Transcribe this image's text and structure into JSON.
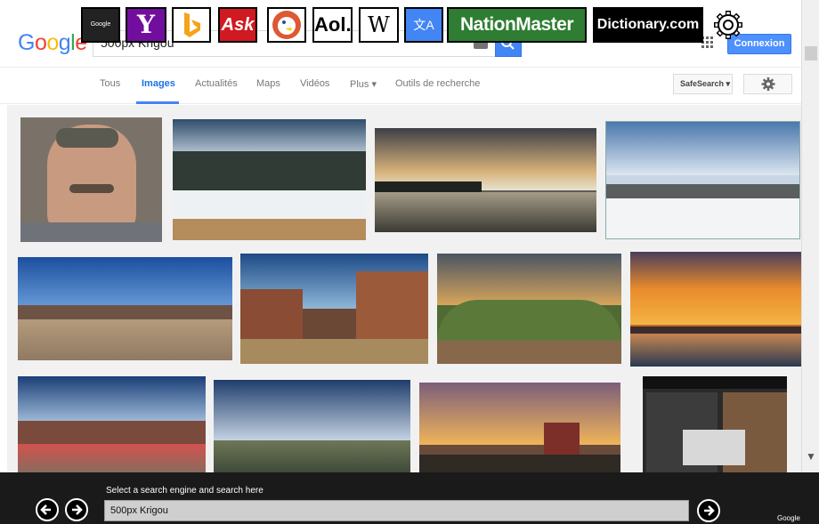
{
  "engines": [
    {
      "name": "Google",
      "label": "Google"
    },
    {
      "name": "Yahoo",
      "label": "Y"
    },
    {
      "name": "Bing",
      "label": ""
    },
    {
      "name": "Ask",
      "label": "Ask"
    },
    {
      "name": "DuckDuckGo",
      "label": ""
    },
    {
      "name": "Aol",
      "label": "Aol."
    },
    {
      "name": "Wikipedia",
      "label": "W"
    },
    {
      "name": "Translate",
      "label": "文A"
    },
    {
      "name": "NationMaster",
      "label": "NationMaster"
    },
    {
      "name": "Dictionary",
      "label": "Dictionary.com"
    }
  ],
  "google": {
    "logo_letters": [
      "G",
      "o",
      "o",
      "g",
      "l",
      "e"
    ],
    "logo_colors": [
      "#4285f4",
      "#ea4335",
      "#fbbc05",
      "#4285f4",
      "#34a853",
      "#ea4335"
    ],
    "query": "500px Krigou",
    "signin_label": "Connexion"
  },
  "nav": {
    "tabs": [
      "Tous",
      "Images",
      "Actualités",
      "Maps",
      "Vidéos",
      "Plus ▾",
      "Outils de recherche"
    ],
    "active_tab": "Images",
    "safesearch_label": "SafeSearch ▾"
  },
  "bottom": {
    "prompt": "Select a search  engine and search here",
    "input_value": "500px Krigou",
    "current_engine": "Google"
  },
  "colors": {
    "accent": "#4285f4",
    "bar_bg": "#1a1a1a"
  }
}
